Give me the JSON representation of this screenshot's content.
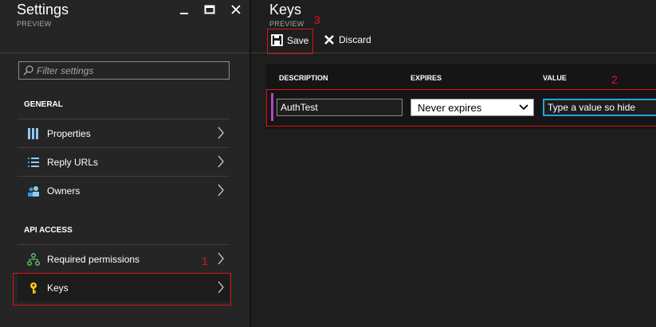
{
  "settings_blade": {
    "title": "Settings",
    "subtitle": "PREVIEW",
    "filter_placeholder": "Filter settings",
    "sections": [
      {
        "label": "GENERAL",
        "items": [
          {
            "label": "Properties",
            "icon": "properties-icon"
          },
          {
            "label": "Reply URLs",
            "icon": "list-icon"
          },
          {
            "label": "Owners",
            "icon": "users-icon"
          }
        ]
      },
      {
        "label": "API ACCESS",
        "items": [
          {
            "label": "Required permissions",
            "icon": "network-icon"
          },
          {
            "label": "Keys",
            "icon": "key-icon"
          }
        ]
      }
    ]
  },
  "keys_blade": {
    "title": "Keys",
    "subtitle": "PREVIEW",
    "toolbar": {
      "save_label": "Save",
      "discard_label": "Discard"
    },
    "table": {
      "columns": [
        "DESCRIPTION",
        "EXPIRES",
        "VALUE"
      ],
      "row": {
        "description": "AuthTest",
        "expires": "Never expires",
        "value": "Type a value so hide"
      }
    }
  },
  "annotations": [
    "1",
    "2",
    "3"
  ],
  "colors": {
    "accent": "#2d9fd8",
    "annotation": "#e81123",
    "row_marker": "#b146c2",
    "key_icon": "#f2c811"
  }
}
